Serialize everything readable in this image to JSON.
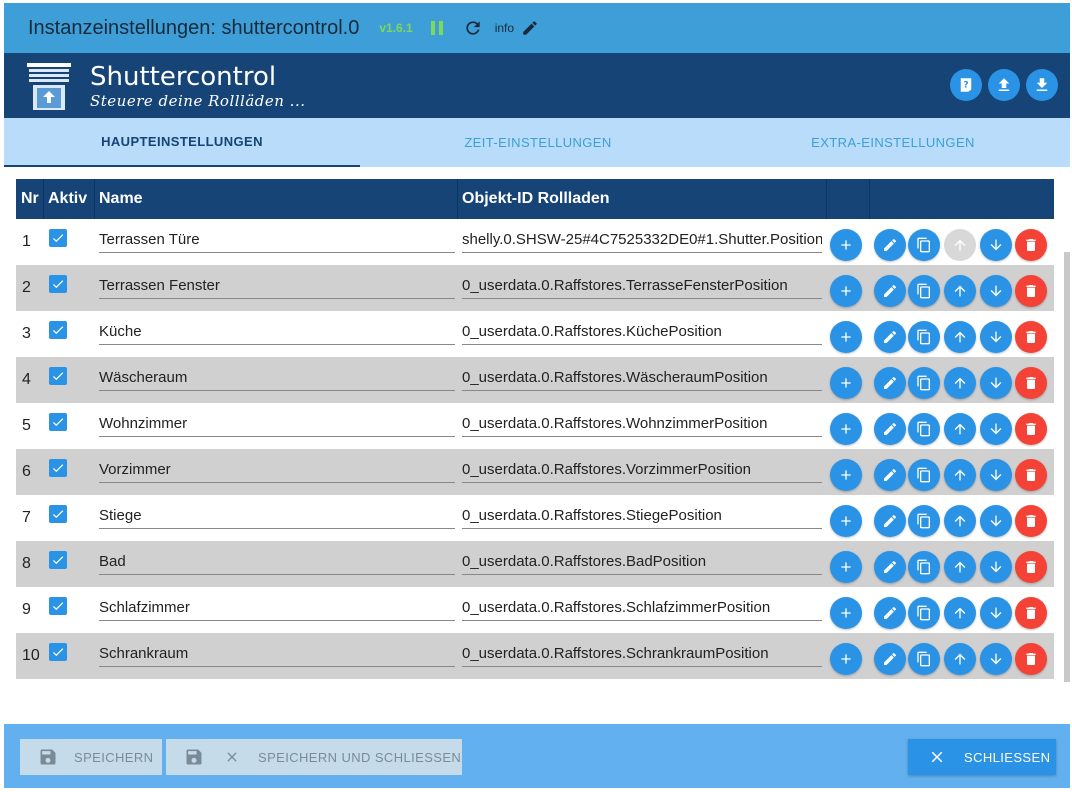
{
  "window": {
    "title": "Instanzeinstellungen: shuttercontrol.0",
    "version": "v1.6.1",
    "pause_icon": "pause-icon",
    "refresh_icon": "refresh-icon",
    "info_label": "info",
    "edit_icon": "pencil-icon"
  },
  "app": {
    "name": "Shuttercontrol",
    "subtitle": "Steuere deine Rollläden ...",
    "logo_icon": "shutter-logo-icon",
    "actions": [
      "help-icon",
      "upload-icon",
      "download-icon"
    ]
  },
  "tabs": [
    {
      "label": "HAUPTEINSTELLUNGEN",
      "active": true
    },
    {
      "label": "ZEIT-EINSTELLUNGEN",
      "active": false
    },
    {
      "label": "EXTRA-EINSTELLUNGEN",
      "active": false
    }
  ],
  "table": {
    "headers": {
      "nr": "Nr",
      "active": "Aktiv",
      "name": "Name",
      "object_id": "Objekt-ID Rollladen"
    },
    "rows": [
      {
        "nr": "1",
        "active": true,
        "name": "Terrassen Türe",
        "object_id": "shelly.0.SHSW-25#4C7525332DE0#1.Shutter.Position",
        "up_enabled": false
      },
      {
        "nr": "2",
        "active": true,
        "name": "Terrassen Fenster",
        "object_id": "0_userdata.0.Raffstores.TerrasseFensterPosition",
        "up_enabled": true
      },
      {
        "nr": "3",
        "active": true,
        "name": "Küche",
        "object_id": "0_userdata.0.Raffstores.KüchePosition",
        "up_enabled": true
      },
      {
        "nr": "4",
        "active": true,
        "name": "Wäscheraum",
        "object_id": "0_userdata.0.Raffstores.WäscheraumPosition",
        "up_enabled": true
      },
      {
        "nr": "5",
        "active": true,
        "name": "Wohnzimmer",
        "object_id": "0_userdata.0.Raffstores.WohnzimmerPosition",
        "up_enabled": true
      },
      {
        "nr": "6",
        "active": true,
        "name": "Vorzimmer",
        "object_id": "0_userdata.0.Raffstores.VorzimmerPosition",
        "up_enabled": true
      },
      {
        "nr": "7",
        "active": true,
        "name": "Stiege",
        "object_id": "0_userdata.0.Raffstores.StiegePosition",
        "up_enabled": true
      },
      {
        "nr": "8",
        "active": true,
        "name": "Bad",
        "object_id": "0_userdata.0.Raffstores.BadPosition",
        "up_enabled": true
      },
      {
        "nr": "9",
        "active": true,
        "name": "Schlafzimmer",
        "object_id": "0_userdata.0.Raffstores.SchlafzimmerPosition",
        "up_enabled": true
      },
      {
        "nr": "10",
        "active": true,
        "name": "Schrankraum",
        "object_id": "0_userdata.0.Raffstores.SchrankraumPosition",
        "up_enabled": true
      }
    ],
    "row_actions": [
      "add-icon",
      "edit-icon",
      "copy-icon",
      "arrow-up-icon",
      "arrow-down-icon",
      "delete-icon"
    ]
  },
  "footer": {
    "save_label": "SPEICHERN",
    "save_close_label": "SPEICHERN UND SCHLIESSEN",
    "close_label": "SCHLIESSEN",
    "save_icon": "floppy-disk-icon",
    "close_icon": "close-icon"
  },
  "colors": {
    "titlebar": "#3d9ed8",
    "appbar": "#164477",
    "tabs_bg": "#b8dcf9",
    "accent": "#2b93e6",
    "delete": "#f44336",
    "version": "#7ed957",
    "footer": "#62b0ef"
  }
}
